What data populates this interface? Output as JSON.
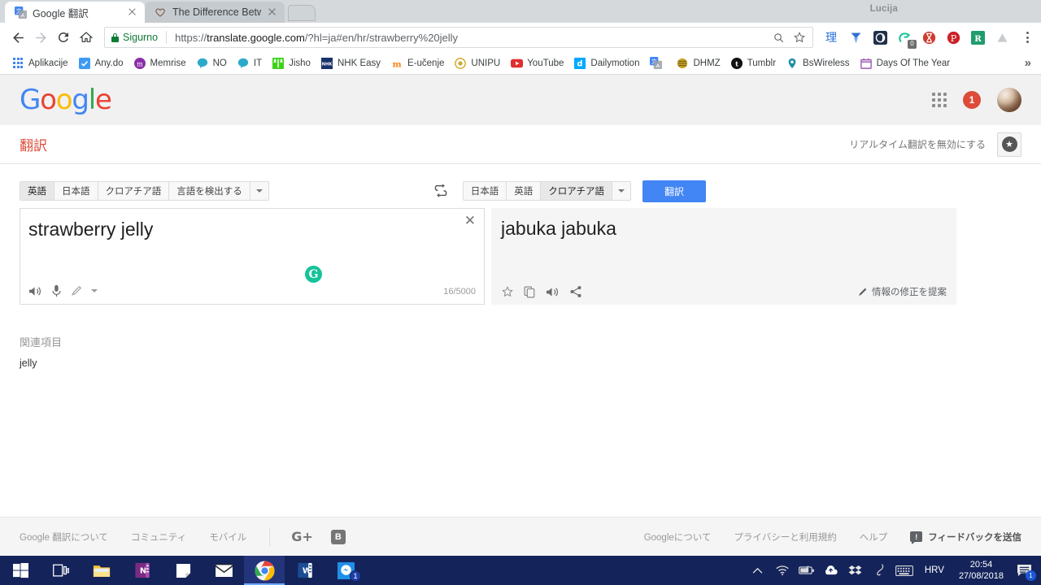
{
  "browser": {
    "profile_name": "Lucija",
    "tabs": [
      {
        "title": "Google 翻訳",
        "favicon": "google-translate-icon",
        "active": true
      },
      {
        "title": "The Difference Between J",
        "favicon": "heart-icon",
        "active": false
      }
    ],
    "omnibox": {
      "security_label": "Sigurno",
      "url_scheme": "https://",
      "url_host": "translate.google.com",
      "url_path": "/?hl=ja#en/hr/strawberry%20jelly",
      "search_icon": "search-icon",
      "bookmark_icon": "star-icon"
    },
    "extensions": [
      {
        "name": "rikaikun-extension",
        "glyph": "理"
      },
      {
        "name": "yomichan-extension",
        "glyph": "Y"
      },
      {
        "name": "dark-reader-extension",
        "glyph": "●"
      },
      {
        "name": "grammarly-extension",
        "glyph": "G",
        "badge": "0"
      },
      {
        "name": "ublock-extension",
        "glyph": "⧗"
      },
      {
        "name": "pinterest-extension",
        "glyph": "P"
      },
      {
        "name": "readability-extension",
        "glyph": "R"
      },
      {
        "name": "drive-extension",
        "glyph": "▲"
      }
    ],
    "menu_icon": "kebab-menu-icon",
    "bookmarks": [
      {
        "label": "Aplikacije",
        "icon": "apps-grid-icon"
      },
      {
        "label": "Any.do",
        "icon": "anydo-icon"
      },
      {
        "label": "Memrise",
        "icon": "memrise-icon"
      },
      {
        "label": "NO",
        "icon": "speech-bubble-icon"
      },
      {
        "label": "IT",
        "icon": "speech-bubble-icon"
      },
      {
        "label": "Jisho",
        "icon": "jisho-icon"
      },
      {
        "label": "NHK Easy",
        "icon": "nhk-icon"
      },
      {
        "label": "E-učenje",
        "icon": "moodle-icon"
      },
      {
        "label": "UNIPU",
        "icon": "unipu-icon"
      },
      {
        "label": "YouTube",
        "icon": "youtube-icon"
      },
      {
        "label": "Dailymotion",
        "icon": "dailymotion-icon"
      },
      {
        "label": "",
        "icon": "google-translate-icon"
      },
      {
        "label": "DHMZ",
        "icon": "dhmz-icon"
      },
      {
        "label": "Tumblr",
        "icon": "tumblr-icon"
      },
      {
        "label": "BsWireless",
        "icon": "location-pin-icon"
      },
      {
        "label": "Days Of The Year",
        "icon": "calendar-icon"
      }
    ],
    "bookmarks_overflow": "»"
  },
  "gbar": {
    "logo": {
      "g1": "G",
      "o1": "o",
      "o2": "o",
      "g2": "g",
      "l": "l",
      "e": "e"
    },
    "apps_icon": "google-apps-icon",
    "notification_count": "1",
    "avatar": "user-avatar"
  },
  "header": {
    "title": "翻訳",
    "realtime_label": "リアルタイム翻訳を無効にする",
    "star_button_icon": "star-icon"
  },
  "languages": {
    "source_tabs": [
      "英語",
      "日本語",
      "クロアチア語",
      "言語を検出する"
    ],
    "source_selected": "英語",
    "target_tabs": [
      "日本語",
      "英語",
      "クロアチア語"
    ],
    "target_selected": "クロアチア語",
    "swap_icon": "swap-arrows-icon",
    "translate_button": "翻訳"
  },
  "source_pane": {
    "text": "strawberry jelly",
    "clear_icon": "close-icon",
    "counter": "16/5000",
    "tools": [
      "speaker-icon",
      "microphone-icon",
      "handwrite-pencil-icon",
      "dropdown-caret-icon"
    ],
    "grammarly_badge": "G"
  },
  "target_pane": {
    "text": "jabuka jabuka",
    "tools": [
      "star-icon",
      "copy-icon",
      "speaker-icon",
      "share-icon"
    ],
    "suggest_label": "情報の修正を提案",
    "suggest_icon": "pencil-icon"
  },
  "related": {
    "heading": "関連項目",
    "items": [
      "jelly"
    ]
  },
  "footer": {
    "left_links": [
      "Google 翻訳について",
      "コミュニティ",
      "モバイル"
    ],
    "social": [
      {
        "name": "google-plus-icon",
        "glyph": "G+"
      },
      {
        "name": "blogger-icon",
        "glyph": "B"
      }
    ],
    "right_links": [
      "Googleについて",
      "プライバシーと利用規約",
      "ヘルプ"
    ],
    "feedback_label": "フィードバックを送信",
    "feedback_icon": "feedback-icon"
  },
  "taskbar": {
    "items": [
      {
        "name": "start-button",
        "icon": "windows-logo-icon"
      },
      {
        "name": "task-view-button",
        "icon": "task-view-icon"
      },
      {
        "name": "file-explorer",
        "icon": "folder-icon"
      },
      {
        "name": "onenote",
        "icon": "onenote-icon"
      },
      {
        "name": "sticky-notes",
        "icon": "sticky-note-icon"
      },
      {
        "name": "mail",
        "icon": "envelope-icon"
      },
      {
        "name": "google-chrome",
        "icon": "chrome-icon",
        "active": true
      },
      {
        "name": "word",
        "icon": "word-icon"
      },
      {
        "name": "messenger",
        "icon": "messenger-icon",
        "badge": "1"
      }
    ],
    "tray": [
      {
        "name": "show-hidden-icons",
        "icon": "chevron-up-icon"
      },
      {
        "name": "wifi-status",
        "icon": "wifi-icon"
      },
      {
        "name": "battery-status",
        "icon": "battery-icon"
      },
      {
        "name": "onedrive",
        "icon": "cloud-icon"
      },
      {
        "name": "dropbox",
        "icon": "dropbox-icon"
      },
      {
        "name": "pen-tool",
        "icon": "pen-icon"
      },
      {
        "name": "touch-keyboard",
        "icon": "keyboard-icon"
      }
    ],
    "language": "HRV",
    "time": "20:54",
    "date": "27/08/2018",
    "action_center_badge": "1"
  }
}
